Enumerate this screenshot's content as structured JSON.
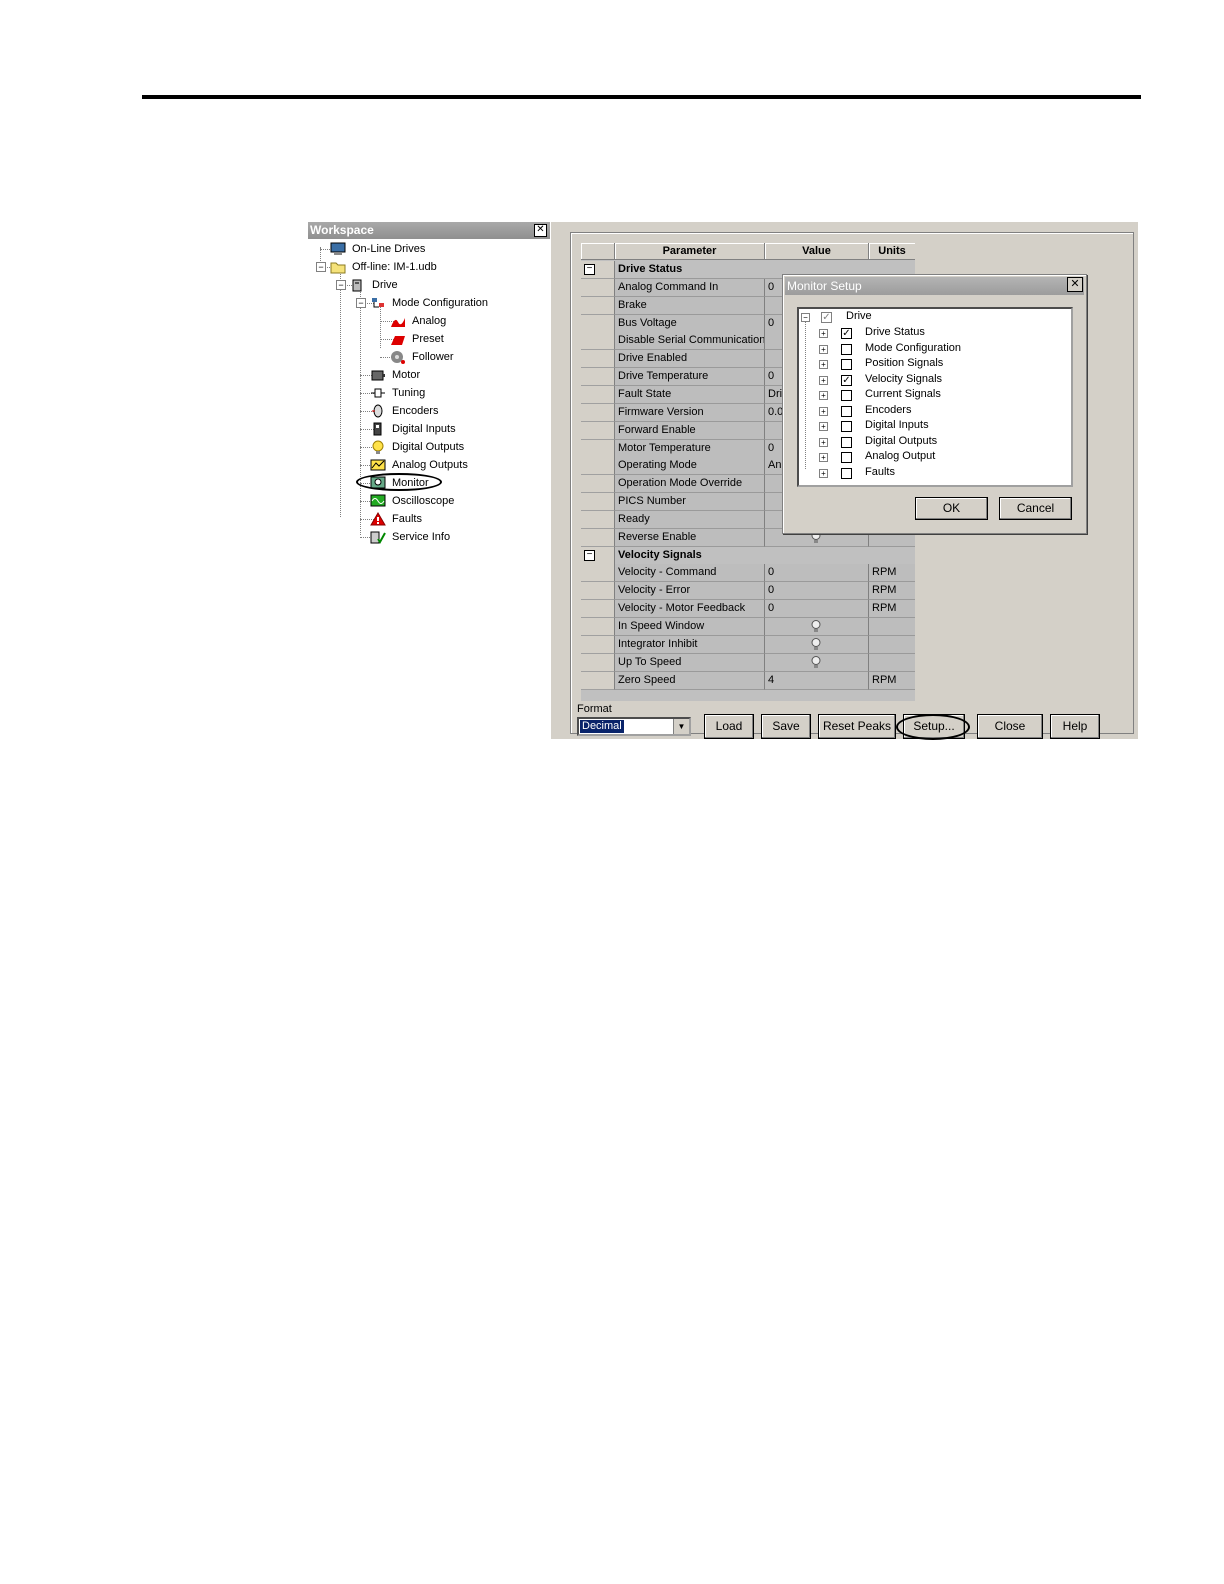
{
  "workspace": {
    "title": "Workspace",
    "close": "✕",
    "tree": [
      {
        "label": "On-Line Drives",
        "icon": "computer-icon"
      },
      {
        "label": "Off-line: IM-1.udb",
        "icon": "folder-icon"
      },
      {
        "label": "Drive",
        "icon": "drive-icon"
      },
      {
        "label": "Mode Configuration",
        "icon": "mode-config-icon"
      },
      {
        "label": "Analog",
        "icon": "analog-icon"
      },
      {
        "label": "Preset",
        "icon": "preset-icon"
      },
      {
        "label": "Follower",
        "icon": "follower-icon"
      },
      {
        "label": "Motor",
        "icon": "motor-icon"
      },
      {
        "label": "Tuning",
        "icon": "tuning-icon"
      },
      {
        "label": "Encoders",
        "icon": "encoder-icon"
      },
      {
        "label": "Digital Inputs",
        "icon": "digital-input-icon"
      },
      {
        "label": "Digital Outputs",
        "icon": "bulb-icon"
      },
      {
        "label": "Analog Outputs",
        "icon": "analog-output-icon"
      },
      {
        "label": "Monitor",
        "icon": "monitor-icon"
      },
      {
        "label": "Oscilloscope",
        "icon": "oscilloscope-icon"
      },
      {
        "label": "Faults",
        "icon": "warning-icon"
      },
      {
        "label": "Service Info",
        "icon": "service-info-icon"
      }
    ]
  },
  "grid": {
    "headers": {
      "parameter": "Parameter",
      "value": "Value",
      "units": "Units"
    },
    "rows": [
      {
        "type": "group",
        "label": "Drive Status"
      },
      {
        "label": "Analog Command In",
        "value": "0",
        "units": ""
      },
      {
        "label": "Brake",
        "value": "",
        "units": ""
      },
      {
        "label": "Bus Voltage",
        "value": "0",
        "units": ""
      },
      {
        "label": "Disable Serial Communications",
        "value": "",
        "units": ""
      },
      {
        "label": "Drive Enabled",
        "value": "",
        "units": ""
      },
      {
        "label": "Drive Temperature",
        "value": "0",
        "units": ""
      },
      {
        "label": "Fault State",
        "value": "Dri",
        "units": ""
      },
      {
        "label": "Firmware Version",
        "value": "0.0",
        "units": ""
      },
      {
        "label": "Forward Enable",
        "value": "",
        "units": ""
      },
      {
        "label": "Motor Temperature",
        "value": "0",
        "units": ""
      },
      {
        "label": "Operating Mode",
        "value": "An",
        "units": ""
      },
      {
        "label": "Operation Mode Override",
        "value": "",
        "units": ""
      },
      {
        "label": "PICS Number",
        "value": "",
        "units": ""
      },
      {
        "label": "Ready",
        "value": "",
        "units": ""
      },
      {
        "label": "Reverse Enable",
        "value": "",
        "units": "",
        "bulb": true
      },
      {
        "type": "group",
        "label": "Velocity Signals"
      },
      {
        "label": "Velocity - Command",
        "value": "0",
        "units": "RPM"
      },
      {
        "label": "Velocity - Error",
        "value": "0",
        "units": "RPM"
      },
      {
        "label": "Velocity - Motor Feedback",
        "value": "0",
        "units": "RPM"
      },
      {
        "label": "In Speed Window",
        "value": "",
        "units": "",
        "bulb": true
      },
      {
        "label": "Integrator Inhibit",
        "value": "",
        "units": "",
        "bulb": true
      },
      {
        "label": "Up To Speed",
        "value": "",
        "units": "",
        "bulb": true
      },
      {
        "label": "Zero Speed",
        "value": "4",
        "units": "RPM"
      }
    ]
  },
  "format": {
    "label": "Format",
    "value": "Decimal"
  },
  "buttons": {
    "load": "Load",
    "save": "Save",
    "reset_peaks": "Reset Peaks",
    "setup": "Setup...",
    "close": "Close",
    "help": "Help"
  },
  "dialog": {
    "title": "Monitor Setup",
    "close": "✕",
    "root": "Drive",
    "items": [
      {
        "label": "Drive Status",
        "checked": true
      },
      {
        "label": "Mode Configuration",
        "checked": false
      },
      {
        "label": "Position Signals",
        "checked": false
      },
      {
        "label": "Velocity Signals",
        "checked": true
      },
      {
        "label": "Current Signals",
        "checked": false
      },
      {
        "label": "Encoders",
        "checked": false
      },
      {
        "label": "Digital Inputs",
        "checked": false
      },
      {
        "label": "Digital Outputs",
        "checked": false
      },
      {
        "label": "Analog Output",
        "checked": false
      },
      {
        "label": "Faults",
        "checked": false
      }
    ],
    "ok": "OK",
    "cancel": "Cancel"
  }
}
